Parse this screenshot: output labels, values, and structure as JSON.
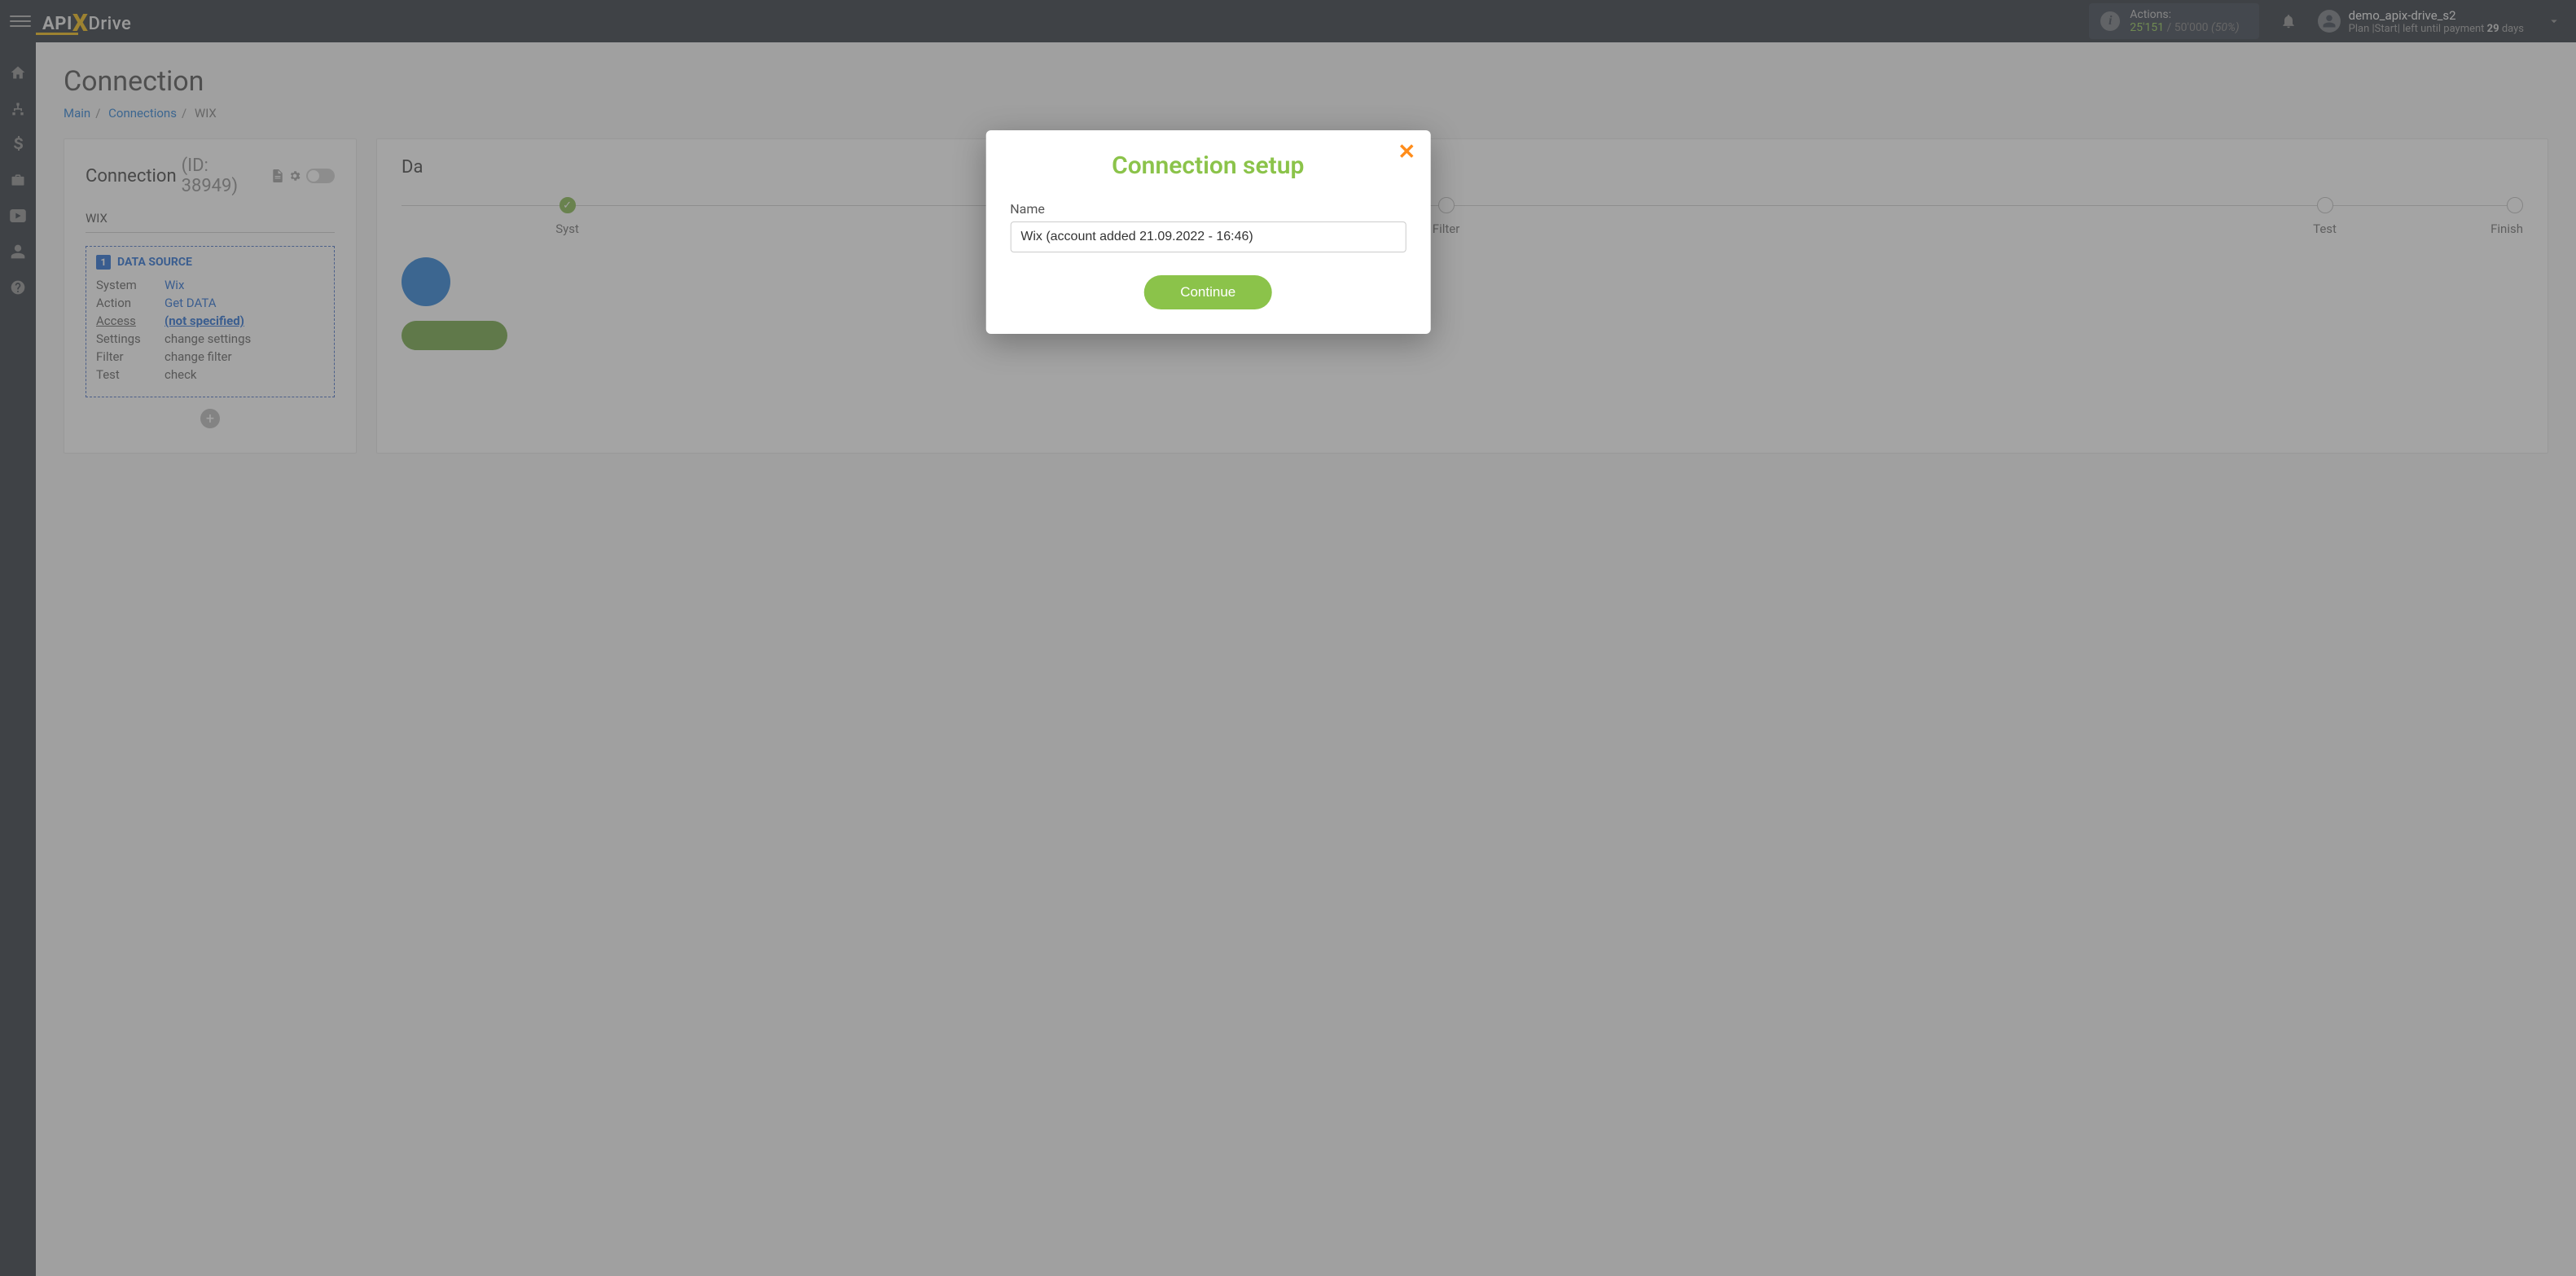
{
  "topbar": {
    "actions_label": "Actions:",
    "actions_used": "25'151",
    "actions_sep": " / ",
    "actions_total": "50'000",
    "actions_pct": "(50%)",
    "username": "demo_apix-drive_s2",
    "plan_prefix": "Plan |",
    "plan_name": "Start",
    "plan_mid": "| left until payment ",
    "plan_days": "29",
    "plan_suffix": " days"
  },
  "page": {
    "title": "Connection",
    "breadcrumb": {
      "main": "Main",
      "connections": "Connections",
      "current": "WIX"
    }
  },
  "left_card": {
    "heading": "Connection",
    "id_text": "(ID: 38949)",
    "conn_name": "WIX",
    "ds_header": "DATA SOURCE",
    "rows": {
      "system_k": "System",
      "system_v": "Wix",
      "action_k": "Action",
      "action_v": "Get DATA",
      "access_k": "Access",
      "access_v": "(not specified)",
      "settings_k": "Settings",
      "settings_v": "change settings",
      "filter_k": "Filter",
      "filter_v": "change filter",
      "test_k": "Test",
      "test_v": "check"
    }
  },
  "right_card": {
    "title_prefix": "Da",
    "steps": {
      "system": "Syst",
      "filter": "Filter",
      "test": "Test",
      "finish": "Finish"
    }
  },
  "modal": {
    "title": "Connection setup",
    "label": "Name",
    "value": "Wix (account added 21.09.2022 - 16:46)",
    "button": "Continue"
  }
}
